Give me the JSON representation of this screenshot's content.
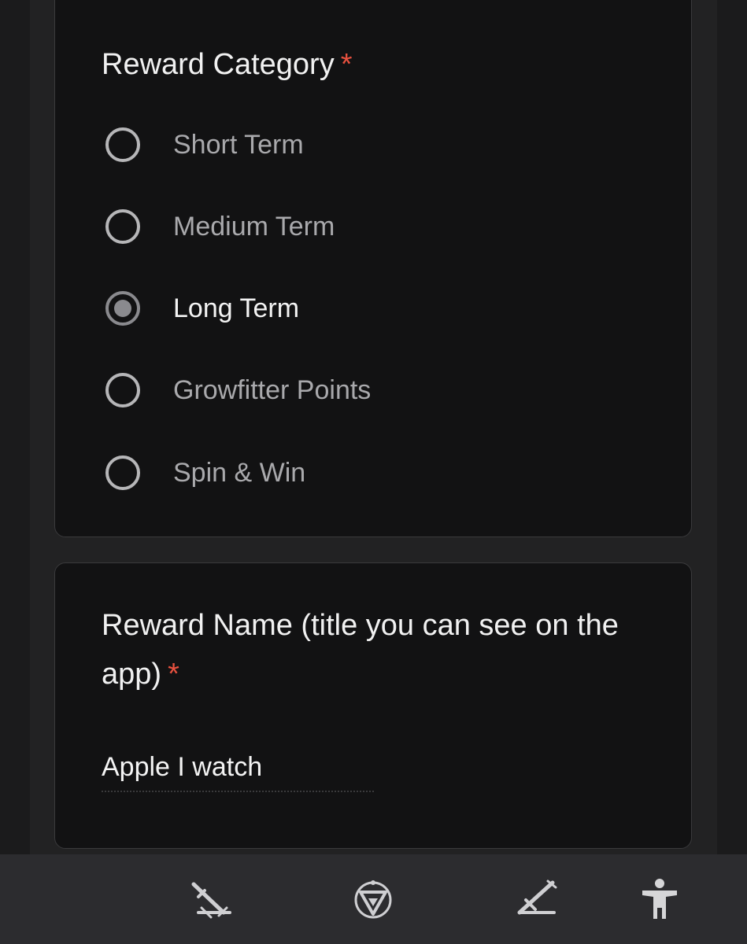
{
  "reward_category": {
    "question": "Reward Category",
    "required_mark": "*",
    "options": [
      {
        "label": "Short Term",
        "selected": false
      },
      {
        "label": "Medium Term",
        "selected": false
      },
      {
        "label": "Long Term",
        "selected": true
      },
      {
        "label": "Growfitter Points",
        "selected": false
      },
      {
        "label": "Spin & Win",
        "selected": false
      }
    ]
  },
  "reward_name": {
    "question": "Reward Name (title you can see on the app)",
    "required_mark": "*",
    "value": "Apple I watch"
  },
  "bottom_nav": {
    "icons": [
      "crossed-swords-icon",
      "triangle-shield-icon",
      "dagger-icon",
      "accessibility-icon"
    ]
  },
  "colors": {
    "background": "#1b1b1c",
    "card": "#121213",
    "required": "#e8513f",
    "bottom_bar": "#2c2c2f"
  }
}
